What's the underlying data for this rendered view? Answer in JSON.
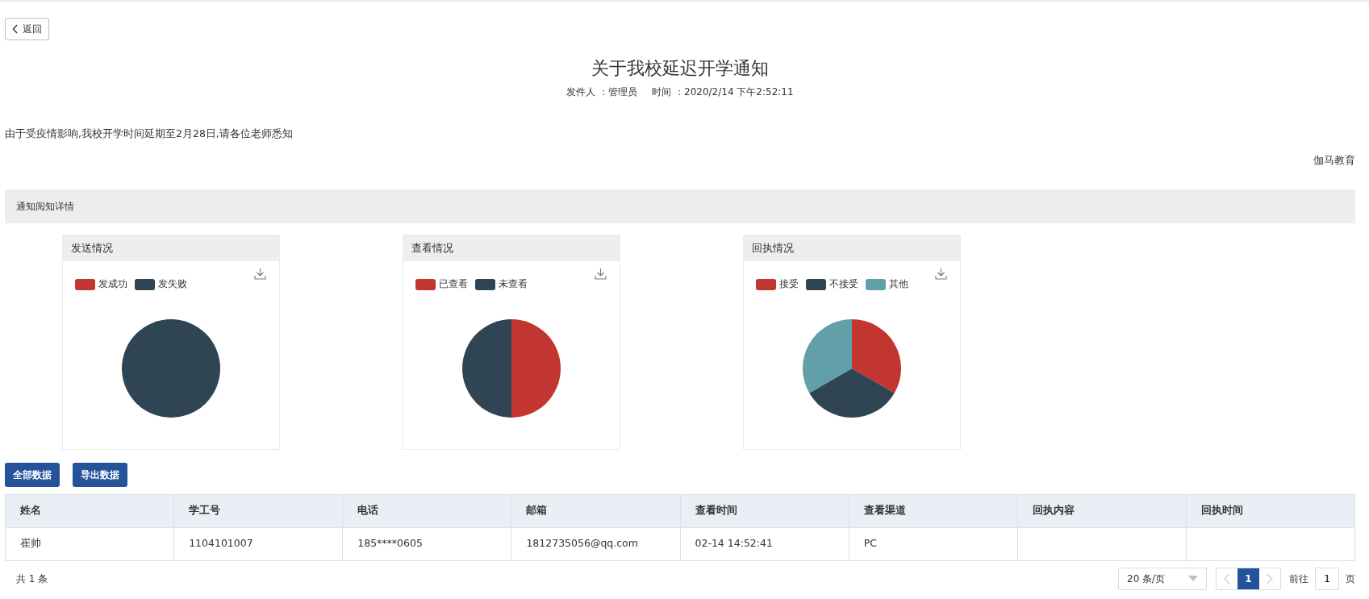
{
  "back_button": {
    "label": "返回"
  },
  "notice": {
    "title": "关于我校延迟开学通知",
    "sender_label": "发件人 ：",
    "sender": "管理员",
    "time_label": "时间 ：",
    "time": "2020/2/14 下午2:52:11",
    "body": "由于受疫情影响,我校开学时间延期至2月28日,请各位老师悉知",
    "signature": "伽马教育"
  },
  "section": {
    "title": "通知阅知详情"
  },
  "charts": [
    {
      "title": "发送情况",
      "legend": [
        {
          "label": "发成功",
          "color": "#c23531"
        },
        {
          "label": "发失败",
          "color": "#2f4554"
        }
      ]
    },
    {
      "title": "查看情况",
      "legend": [
        {
          "label": "已查看",
          "color": "#c23531"
        },
        {
          "label": "未查看",
          "color": "#2f4554"
        }
      ]
    },
    {
      "title": "回执情况",
      "legend": [
        {
          "label": "接受",
          "color": "#c23531"
        },
        {
          "label": "不接受",
          "color": "#2f4554"
        },
        {
          "label": "其他",
          "color": "#61a0a8"
        }
      ]
    }
  ],
  "actions": [
    "全部数据",
    "导出数据"
  ],
  "table": {
    "columns": [
      "姓名",
      "学工号",
      "电话",
      "邮箱",
      "查看时间",
      "查看渠道",
      "回执内容",
      "回执时间"
    ],
    "rows": [
      [
        "崔帅",
        "1104101007",
        "185****0605",
        "1812735056@qq.com",
        "02-14 14:52:41",
        "PC",
        "",
        ""
      ]
    ]
  },
  "pagination": {
    "total": "共 1 条",
    "page_size": "20 条/页",
    "prev_disabled": true,
    "next_disabled": true,
    "pages": [
      {
        "label": "1",
        "selected": true
      }
    ],
    "goto_label": "前往",
    "goto_value": "1",
    "page_unit": "页"
  }
}
